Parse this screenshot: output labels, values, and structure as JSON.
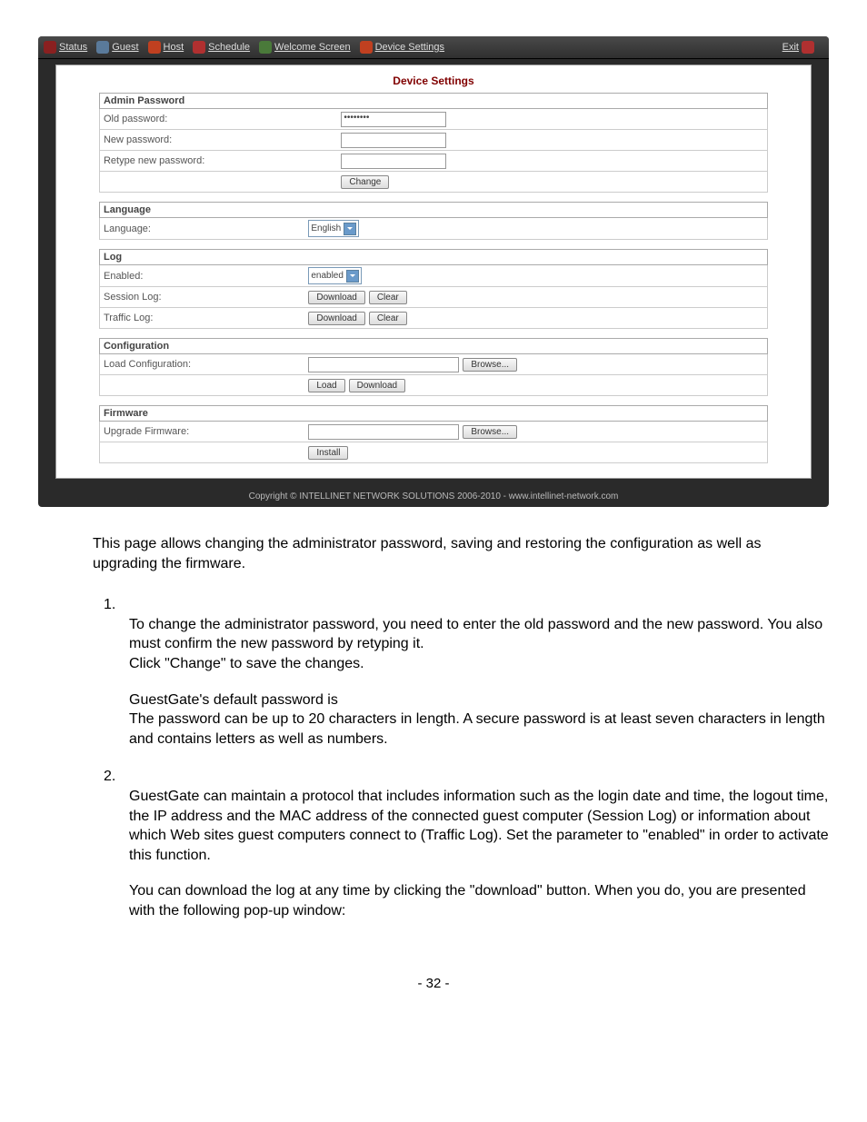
{
  "nav": {
    "status": "Status",
    "guest": "Guest",
    "host": "Host",
    "schedule": "Schedule",
    "welcome": "Welcome Screen",
    "device": "Device Settings",
    "exit": "Exit"
  },
  "panel": {
    "title": "Device Settings",
    "admin": {
      "header": "Admin Password",
      "old_label": "Old password:",
      "old_value": "••••••••",
      "new_label": "New password:",
      "retype_label": "Retype new password:",
      "change_btn": "Change"
    },
    "lang": {
      "header": "Language",
      "label": "Language:",
      "value": "English"
    },
    "log": {
      "header": "Log",
      "enabled_label": "Enabled:",
      "enabled_value": "enabled",
      "session_label": "Session Log:",
      "traffic_label": "Traffic Log:",
      "download_btn": "Download",
      "clear_btn": "Clear"
    },
    "config": {
      "header": "Configuration",
      "load_label": "Load Configuration:",
      "browse_btn": "Browse...",
      "load_btn": "Load",
      "download_btn": "Download"
    },
    "firmware": {
      "header": "Firmware",
      "upgrade_label": "Upgrade Firmware:",
      "browse_btn": "Browse...",
      "install_btn": "Install"
    },
    "copyright": "Copyright © INTELLINET NETWORK SOLUTIONS 2006-2010 - www.intellinet-network.com"
  },
  "doc": {
    "intro": "This page allows changing the administrator password, saving and restoring the configuration as well as upgrading the firmware.",
    "n1": "1.",
    "p1a": "To change the administrator password, you need to enter the old password and the new password. You also must confirm the new password by retyping it.",
    "p1b": "Click \"Change\" to save the changes.",
    "p1c": "GuestGate's default password is",
    "p1d": "The password can be up to 20 characters in length. A secure password is at least seven characters in length and contains letters as well as numbers.",
    "n2": "2.",
    "p2a": "GuestGate can maintain a protocol that includes information such as the login date and time, the logout time, the IP address and the MAC address of the connected guest computer (Session Log) or information about which Web sites guest computers connect to (Traffic Log). Set the parameter to \"enabled\" in order to activate this function.",
    "p2b": "You can download the log at any time by clicking the \"download\" button. When you do, you are presented with the following pop-up window:",
    "page": "- 32 -"
  }
}
